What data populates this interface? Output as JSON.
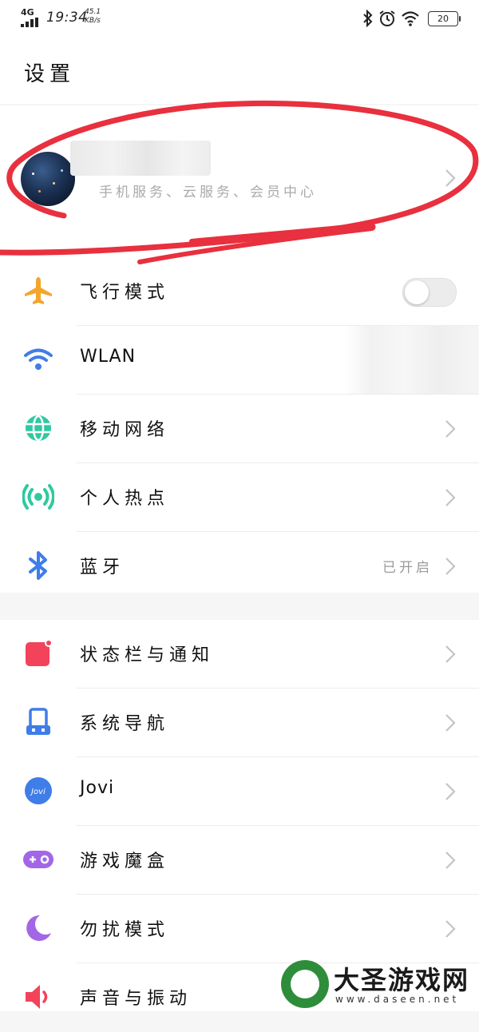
{
  "status_bar": {
    "network": "4G",
    "time": "19:34",
    "speed_value": "45.1",
    "speed_unit": "KB/s",
    "battery": "20",
    "icons": [
      "bluetooth-icon",
      "alarm-icon",
      "wifi-icon",
      "battery-icon"
    ]
  },
  "header": {
    "title": "设置"
  },
  "account": {
    "subtitle": "手机服务、云服务、会员中心"
  },
  "group1": [
    {
      "name": "airplane",
      "label": "飞行模式",
      "icon": "airplane-icon",
      "color": "#f4a52a",
      "control": "toggle",
      "toggle_on": false
    },
    {
      "name": "wlan",
      "label": "WLAN",
      "icon": "wifi-icon",
      "color": "#3f7de8",
      "control": "none"
    },
    {
      "name": "mobile-network",
      "label": "移动网络",
      "icon": "globe-icon",
      "color": "#2fc9a0",
      "control": "chevron"
    },
    {
      "name": "hotspot",
      "label": "个人热点",
      "icon": "hotspot-icon",
      "color": "#2fc9a0",
      "control": "chevron"
    },
    {
      "name": "bluetooth",
      "label": "蓝牙",
      "icon": "bluetooth-icon",
      "color": "#3f7de8",
      "control": "chevron",
      "value": "已开启"
    }
  ],
  "group2": [
    {
      "name": "statusbar-notifications",
      "label": "状态栏与通知",
      "icon": "notification-icon",
      "color": "#f2435b",
      "control": "chevron"
    },
    {
      "name": "system-navigation",
      "label": "系统导航",
      "icon": "navigation-icon",
      "color": "#3f7de8",
      "control": "chevron"
    },
    {
      "name": "jovi",
      "label": "Jovi",
      "icon": "jovi-icon",
      "color": "#3f7de8",
      "control": "chevron"
    },
    {
      "name": "game-box",
      "label": "游戏魔盒",
      "icon": "gamepad-icon",
      "color": "#a367e6",
      "control": "chevron"
    },
    {
      "name": "do-not-disturb",
      "label": "勿扰模式",
      "icon": "moon-icon",
      "color": "#a367e6",
      "control": "chevron"
    },
    {
      "name": "sound-vibration",
      "label": "声音与振动",
      "icon": "speaker-icon",
      "color": "#f2435b",
      "control": "chevron"
    }
  ],
  "watermark": {
    "title": "大圣游戏网",
    "url": "www.daseen.net"
  }
}
